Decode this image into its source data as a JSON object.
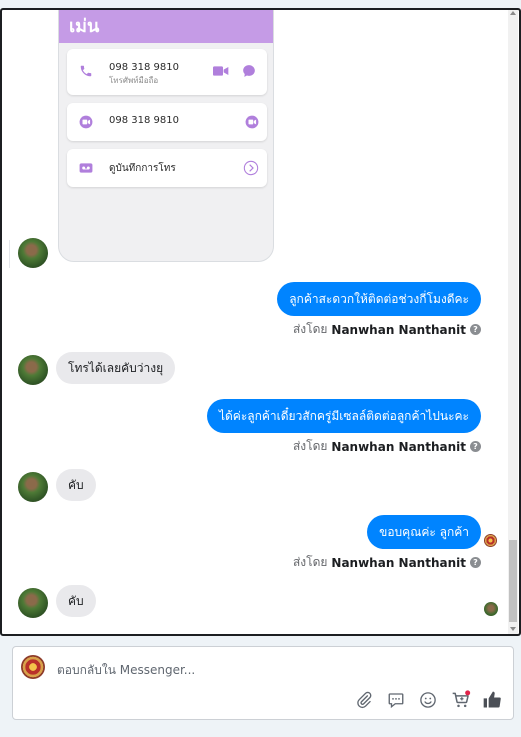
{
  "shared_card": {
    "header_title": "เม่น",
    "rows": [
      {
        "primary": "098 318 9810",
        "secondary": "โทรศัพท์มือถือ"
      },
      {
        "primary": "098 318 9810",
        "secondary": ""
      },
      {
        "primary": "ดูบันทึกการโทร",
        "secondary": ""
      }
    ]
  },
  "messages": [
    {
      "direction": "out",
      "text": "ลูกค้าสะดวกให้ติดต่อช่วงกี่โมงดีคะ",
      "sent_by_prefix": "ส่งโดย",
      "sender": "Nanwhan Nanthanit"
    },
    {
      "direction": "in",
      "text": "โทรได้เลยคับว่างยุ"
    },
    {
      "direction": "out",
      "text": "ได้ค่ะลูกค้าเดี๋ยวสักครู่มีเซลล์ติดต่อลูกค้าไปนะคะ",
      "sent_by_prefix": "ส่งโดย",
      "sender": "Nanwhan Nanthanit"
    },
    {
      "direction": "in",
      "text": "คับ"
    },
    {
      "direction": "out",
      "text": "ขอบคุณค่ะ ลูกค้า",
      "sent_by_prefix": "ส่งโดย",
      "sender": "Nanwhan Nanthanit"
    },
    {
      "direction": "in",
      "text": "คับ"
    }
  ],
  "info_symbol": "?",
  "composer": {
    "placeholder": "ตอบกลับใน Messenger...",
    "tools": [
      "paperclip-icon",
      "speech-bubble-icon",
      "smiley-icon",
      "cart-icon",
      "thumbs-up-icon"
    ]
  },
  "colors": {
    "outgoing_bubble": "#0084ff",
    "incoming_bubble": "#e9e9ec",
    "card_header": "#c59be6",
    "card_icon": "#b07fdc"
  }
}
